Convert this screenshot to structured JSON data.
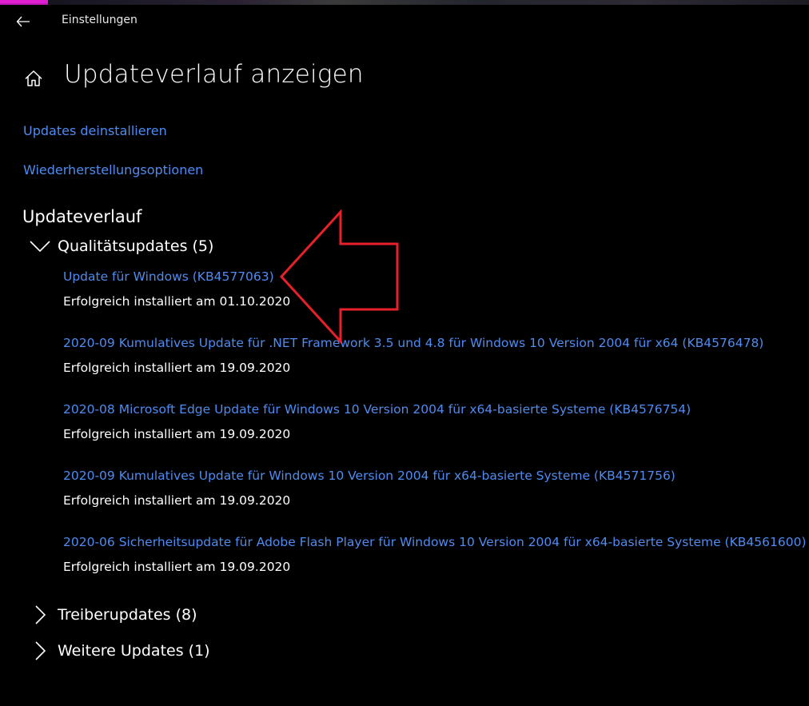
{
  "window": {
    "title": "Einstellungen"
  },
  "header": {
    "title": "Updateverlauf anzeigen"
  },
  "links": {
    "uninstall": "Updates deinstallieren",
    "recovery": "Wiederherstellungsoptionen"
  },
  "history": {
    "title": "Updateverlauf",
    "groups": [
      {
        "label": "Qualitätsupdates (5)",
        "expanded": true,
        "items": [
          {
            "name": "Update für Windows (KB4577063)",
            "status": "Erfolgreich installiert am 01.10.2020"
          },
          {
            "name": "2020-09 Kumulatives Update für .NET Framework 3.5 und 4.8 für Windows 10 Version 2004 für x64 (KB4576478)",
            "status": "Erfolgreich installiert am 19.09.2020"
          },
          {
            "name": "2020-08 Microsoft Edge Update für Windows 10 Version 2004 für x64-basierte Systeme (KB4576754)",
            "status": "Erfolgreich installiert am 19.09.2020"
          },
          {
            "name": "2020-09 Kumulatives Update für Windows 10 Version 2004 für x64-basierte Systeme (KB4571756)",
            "status": "Erfolgreich installiert am 19.09.2020"
          },
          {
            "name": "2020-06 Sicherheitsupdate für Adobe Flash Player für Windows 10 Version 2004 für x64-basierte Systeme (KB4561600)",
            "status": "Erfolgreich installiert am 19.09.2020"
          }
        ]
      },
      {
        "label": "Treiberupdates (8)",
        "expanded": false
      },
      {
        "label": "Weitere Updates (1)",
        "expanded": false
      }
    ]
  },
  "icons": {
    "back": "back-arrow-icon",
    "home": "home-icon",
    "expanded": "chevron-down-icon",
    "collapsed": "chevron-right-icon",
    "annotation": "red-outline-arrow"
  },
  "colors": {
    "background": "#000000",
    "link": "#4f8bf0",
    "text": "#ffffff",
    "annotation": "#e8202a",
    "accent_strip": "#e020d0"
  }
}
